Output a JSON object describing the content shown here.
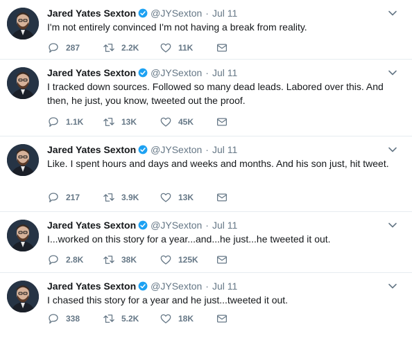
{
  "colors": {
    "text": "#14171a",
    "muted": "#657786",
    "verified": "#1da1f2",
    "divider": "#e6ecf0"
  },
  "tweets": [
    {
      "name": "Jared Yates Sexton",
      "handle": "@JYSexton",
      "separator": "·",
      "date": "Jul 11",
      "text": "I'm not entirely convinced I'm not having a break from reality.",
      "replies": "287",
      "retweets": "2.2K",
      "likes": "11K"
    },
    {
      "name": "Jared Yates Sexton",
      "handle": "@JYSexton",
      "separator": "·",
      "date": "Jul 11",
      "text": "I tracked down sources. Followed so many dead leads. Labored over this. And then, he just, you know, tweeted out the proof.",
      "replies": "1.1K",
      "retweets": "13K",
      "likes": "45K"
    },
    {
      "name": "Jared Yates Sexton",
      "handle": "@JYSexton",
      "separator": "·",
      "date": "Jul 11",
      "text": "Like. I spent hours and days and weeks and months. And his son just, hit tweet.",
      "replies": "217",
      "retweets": "3.9K",
      "likes": "13K"
    },
    {
      "name": "Jared Yates Sexton",
      "handle": "@JYSexton",
      "separator": "·",
      "date": "Jul 11",
      "text": "I...worked on this story for a year...and...he just...he tweeted it out.",
      "replies": "2.8K",
      "retweets": "38K",
      "likes": "125K"
    },
    {
      "name": "Jared Yates Sexton",
      "handle": "@JYSexton",
      "separator": "·",
      "date": "Jul 11",
      "text": "I chased this story for a year and he just...tweeted it out.",
      "replies": "338",
      "retweets": "5.2K",
      "likes": "18K"
    }
  ]
}
